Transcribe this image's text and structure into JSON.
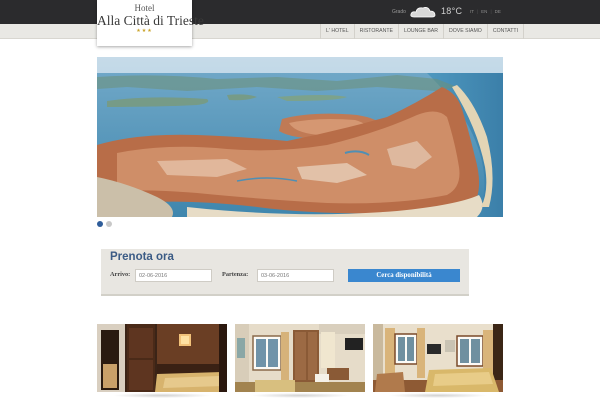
{
  "logo": {
    "line1": "Hotel",
    "line2": "Alla Città di Trieste",
    "stars": "★★★"
  },
  "weather": {
    "city": "Grado",
    "temperature": "18°C",
    "icon": "cloud-icon"
  },
  "languages": [
    "IT",
    "EN",
    "DE"
  ],
  "nav": {
    "items": [
      "L' HOTEL",
      "RISTORANTE",
      "LOUNGE BAR",
      "DOVE SIAMO",
      "CONTATTI"
    ]
  },
  "slider": {
    "total_slides": 2,
    "active_index": 0
  },
  "booking": {
    "title": "Prenota ora",
    "arrival_label": "Arrivo:",
    "arrival_value": "02-06-2016",
    "departure_label": "Partenza:",
    "departure_value": "03-06-2016",
    "button_label": "Cerca disponibilità"
  },
  "colors": {
    "topbar": "#2b2b2d",
    "accent_blue": "#3a87cf",
    "title_blue": "#3b5b85",
    "panel": "#e8e6e1"
  }
}
